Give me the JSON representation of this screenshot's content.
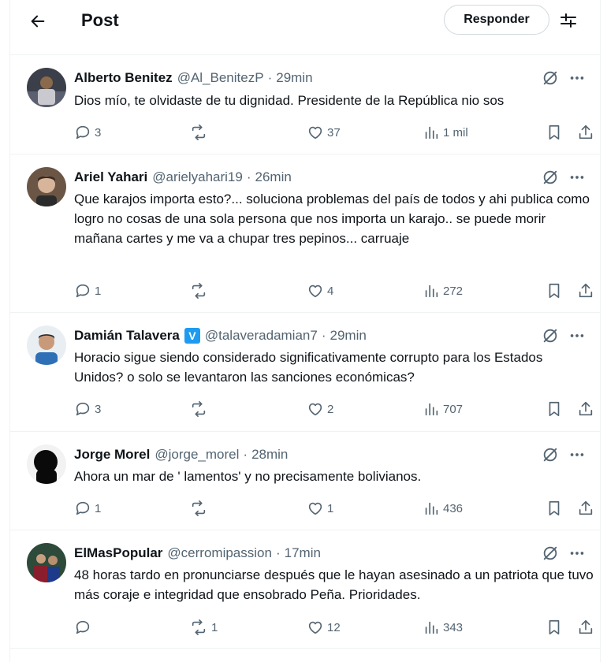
{
  "header": {
    "title": "Post",
    "reply_label": "Responder"
  },
  "colors": {
    "text": "#0f1419",
    "secondary": "#536471",
    "border": "#eff3f4",
    "verified": "#1d9bf0"
  },
  "replies": [
    {
      "name": "Alberto Benitez",
      "handle": "@Al_BenitezP",
      "time": "29min",
      "text": "Dios mío, te olvidaste de tu dignidad. Presidente de la República nio sos",
      "reply_count": "3",
      "repost_count": "",
      "like_count": "37",
      "view_count": "1 mil"
    },
    {
      "name": "Ariel Yahari",
      "handle": "@arielyahari19",
      "time": "26min",
      "text": "Que karajos importa esto?... soluciona problemas del país de todos y ahi publica como logro no cosas de una sola persona que nos importa un karajo.. se puede morir mañana cartes y me va a chupar tres pepinos... carruaje",
      "reply_count": "1",
      "repost_count": "",
      "like_count": "4",
      "view_count": "272"
    },
    {
      "name": "Damián Talavera",
      "verified_badge": "V",
      "handle": "@talaveradamian7",
      "time": "29min",
      "text": "Horacio sigue siendo considerado significativamente corrupto para los Estados Unidos? o solo se levantaron las sanciones económicas?",
      "reply_count": "3",
      "repost_count": "",
      "like_count": "2",
      "view_count": "707"
    },
    {
      "name": "Jorge Morel",
      "handle": "@jorge_morel",
      "time": "28min",
      "text": "Ahora un mar de ' lamentos' y no precisamente bolivianos.",
      "reply_count": "1",
      "repost_count": "",
      "like_count": "1",
      "view_count": "436"
    },
    {
      "name": "ElMasPopular",
      "handle": "@cerromipassion",
      "time": "17min",
      "text": "48 horas tardo en pronunciarse después que le hayan asesinado a un patriota que tuvo más coraje e integridad que ensobrado Peña. Prioridades.",
      "reply_count": "",
      "repost_count": "1",
      "like_count": "12",
      "view_count": "343"
    }
  ],
  "icons": {
    "back": "arrow-left-icon",
    "settings": "sliders-icon",
    "grok": "grok-icon",
    "more": "more-horizontal-icon",
    "reply": "speech-bubble-icon",
    "repost": "repost-icon",
    "like": "heart-icon",
    "views": "bar-chart-icon",
    "bookmark": "bookmark-icon",
    "share": "share-icon"
  }
}
